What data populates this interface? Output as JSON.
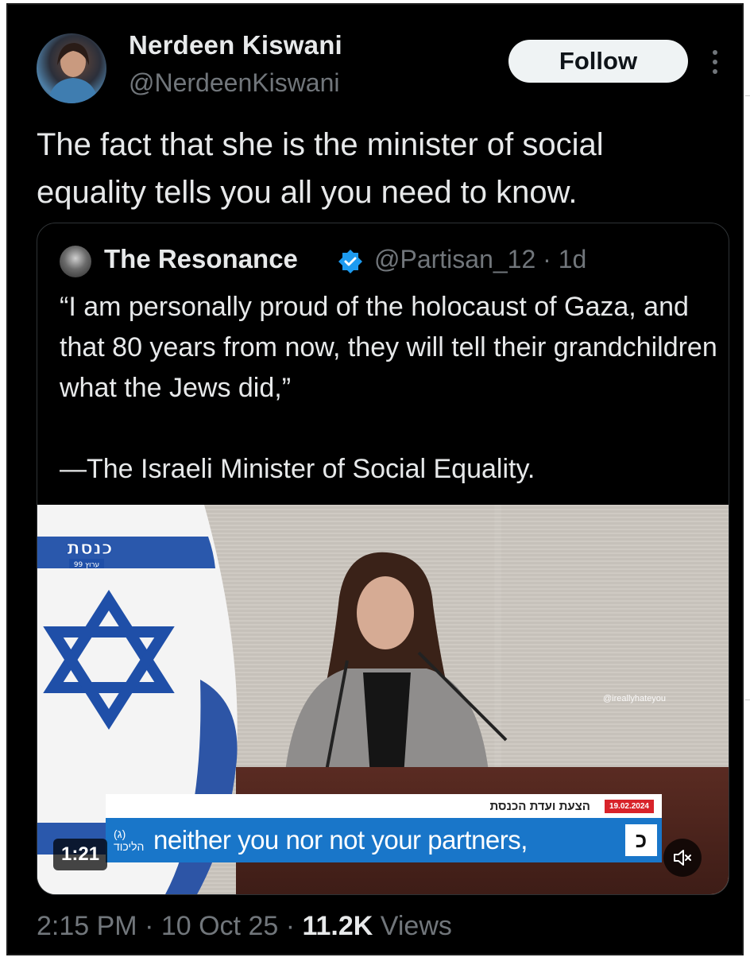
{
  "author": {
    "name": "Nerdeen Kiswani",
    "handle": "@NerdeenKiswani",
    "follow_label": "Follow"
  },
  "tweet": {
    "text": "The fact that she is the minister of social equality tells you all you need to know."
  },
  "quote": {
    "name": "The Resonance",
    "handle_time": "@Partisan_12 · 1d",
    "text": "“I am personally proud of the holocaust of Gaza, and that 80 years from now, they will tell their grandchildren what the Jews did,”\n\n—The Israeli Minister of Social Equality."
  },
  "video": {
    "duration": "1:21",
    "knesset_logo_text": "כנסת",
    "channel_text": "ערוץ 99",
    "watermark": "@ireallyhateyou",
    "caption_heading": "הצעת ועדת הכנסת",
    "caption_date": "19.02.2024",
    "caption_label": "(ג) הליכוד",
    "subtitle": "neither you nor not your partners,",
    "caption_logo": "כ",
    "mute_icon": "speaker-muted-icon"
  },
  "meta": {
    "time_date": "2:15 PM · 10 Oct 25 · ",
    "views_count": "11.2K",
    "views_label": " Views"
  },
  "colors": {
    "background": "#000000",
    "text_primary": "#e7e9ea",
    "text_secondary": "#71767b",
    "verified_blue": "#1d9bf0",
    "caption_blue": "#1976c9"
  }
}
